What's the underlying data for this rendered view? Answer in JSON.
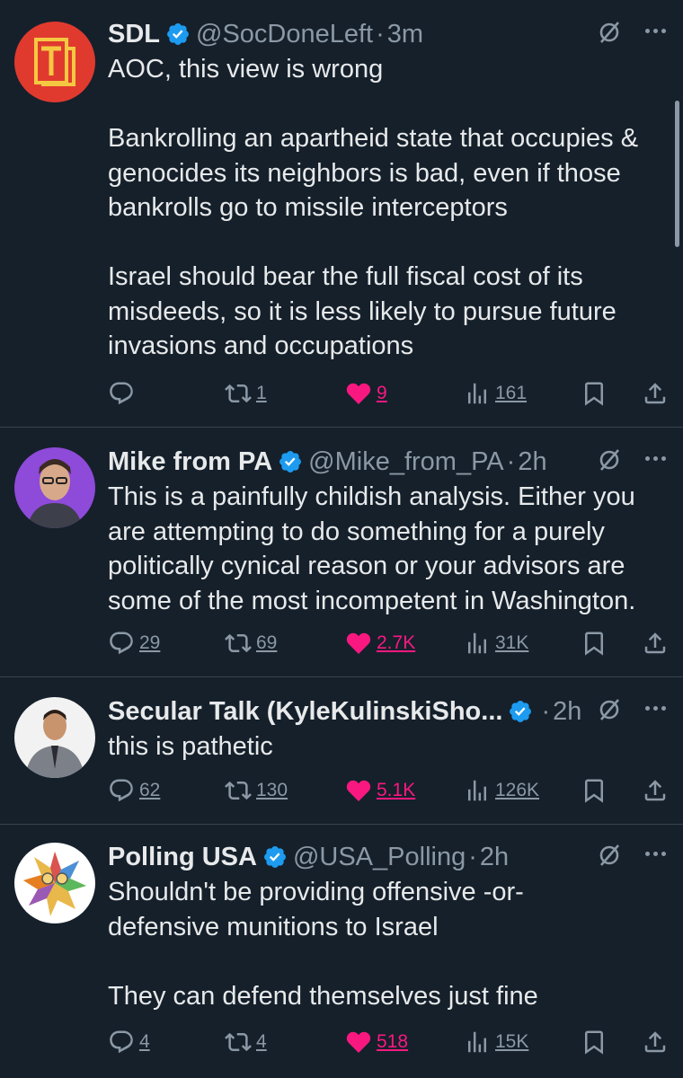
{
  "colors": {
    "background": "#15202b",
    "text": "#e7e9ea",
    "muted": "#8b98a5",
    "verified": "#1d9bf0",
    "like": "#f91880",
    "divider": "#38444d"
  },
  "icons": {
    "reply": "reply-icon",
    "retweet": "retweet-icon",
    "like": "heart-icon",
    "views": "views-icon",
    "bookmark": "bookmark-icon",
    "share": "share-icon",
    "grok": "grok-icon",
    "more": "more-icon",
    "verified": "verified-badge-icon"
  },
  "tweets": [
    {
      "display_name": "SDL",
      "handle": "@SocDoneLeft",
      "time": "3m",
      "text": "AOC, this view is wrong\n\nBankrolling an apartheid state that occupies &\ngenocides its neighbors is bad, even if those\nbankrolls go to missile interceptors\n\nIsrael should bear the full fiscal cost of its\nmisdeeds, so it is less likely to pursue future\ninvasions and occupations",
      "replies": "",
      "retweets": "1",
      "likes": "9",
      "liked": true,
      "views": "161"
    },
    {
      "display_name": "Mike from PA",
      "handle": "@Mike_from_PA",
      "time": "2h",
      "text": "This is a painfully childish analysis. Either you\nare attempting to do something for a purely\npolitically cynical reason or your advisors are\nsome of the most incompetent in Washington.",
      "replies": "29",
      "retweets": "69",
      "likes": "2.7K",
      "liked": true,
      "views": "31K"
    },
    {
      "display_name": "Secular Talk (KyleKulinskiSho...",
      "handle": "",
      "time": "2h",
      "text": "this is pathetic",
      "replies": "62",
      "retweets": "130",
      "likes": "5.1K",
      "liked": true,
      "views": "126K"
    },
    {
      "display_name": "Polling USA",
      "handle": "@USA_Polling",
      "time": "2h",
      "text": "Shouldn't be providing offensive -or-\ndefensive munitions to Israel\n\nThey can defend themselves just fine",
      "replies": "4",
      "retweets": "4",
      "likes": "518",
      "liked": true,
      "views": "15K"
    }
  ]
}
